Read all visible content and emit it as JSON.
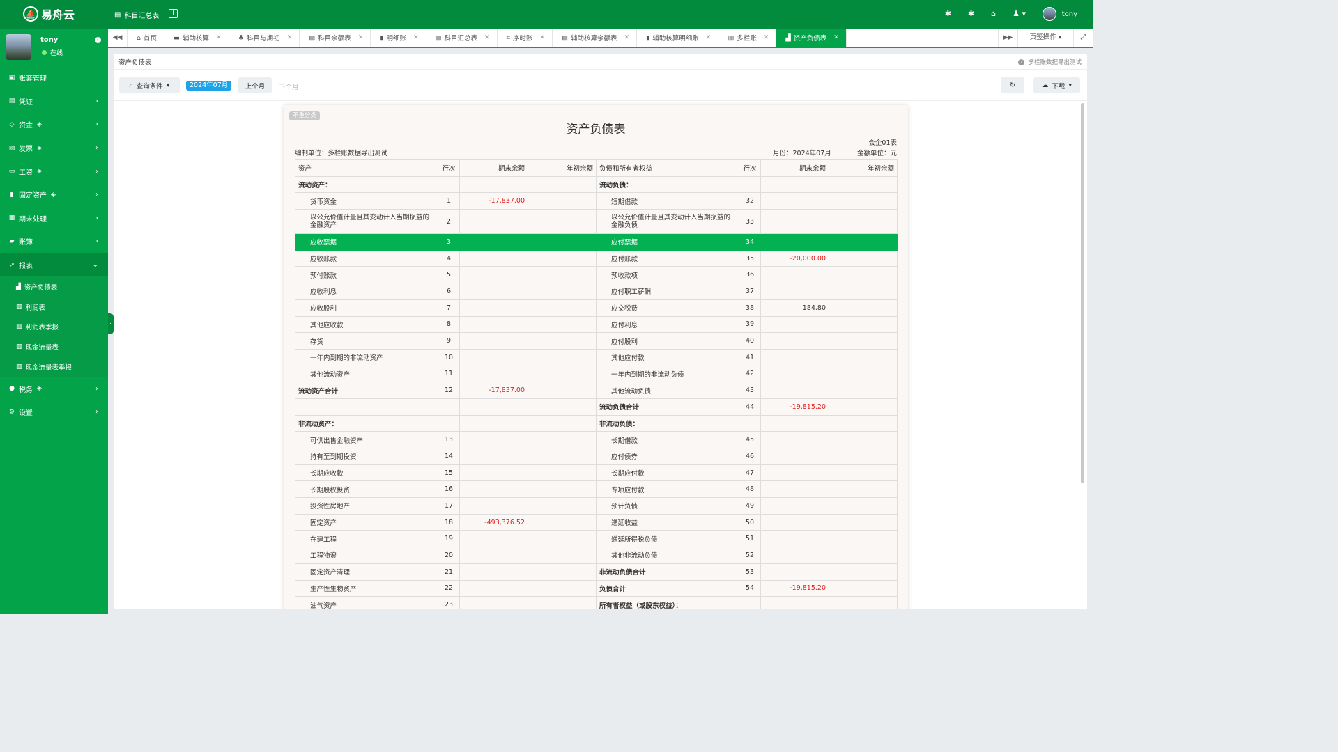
{
  "app": {
    "logo_text": "易舟云",
    "top_crumb": "科目汇总表",
    "user": "tony"
  },
  "sidebar": {
    "user_name": "tony",
    "status": "在线",
    "menu": [
      {
        "label": "账套管理",
        "icon": "book-icon",
        "gem": false,
        "chev": false
      },
      {
        "label": "凭证",
        "icon": "card-icon",
        "gem": false,
        "chev": true
      },
      {
        "label": "资金",
        "icon": "link-icon",
        "gem": true,
        "chev": true
      },
      {
        "label": "发票",
        "icon": "invoice-icon",
        "gem": true,
        "chev": true
      },
      {
        "label": "工资",
        "icon": "wallet-icon",
        "gem": true,
        "chev": true
      },
      {
        "label": "固定资产",
        "icon": "building-icon",
        "gem": true,
        "chev": true
      },
      {
        "label": "期末处理",
        "icon": "calendar-icon",
        "gem": false,
        "chev": true
      },
      {
        "label": "账簿",
        "icon": "ledger-icon",
        "gem": false,
        "chev": true
      },
      {
        "label": "报表",
        "icon": "chart-icon",
        "gem": false,
        "chev": true
      }
    ],
    "report_sub": [
      "资产负债表",
      "利润表",
      "利润表季报",
      "现金流量表",
      "现金流量表季报"
    ],
    "bottom_menu": [
      {
        "label": "税务",
        "gem": true
      },
      {
        "label": "设置",
        "gem": false
      }
    ]
  },
  "tabs": [
    "首页",
    "辅助核算",
    "科目与期初",
    "科目余额表",
    "明细账",
    "科目汇总表",
    "序时账",
    "辅助核算余额表",
    "辅助核算明细账",
    "多栏账",
    "资产负债表"
  ],
  "tab_ops": "页签操作",
  "content": {
    "header": "资产负债表",
    "hint": "多栏账数据导出测试",
    "query_btn": "查询条件",
    "month": "2024年07月",
    "prev_btn": "上个月",
    "next_btn": "下个月",
    "download_btn": "下载"
  },
  "report": {
    "badge": "不重分类",
    "title": "资产负债表",
    "form_code": "会企01表",
    "compiler": "编制单位：多栏账数据导出测试",
    "month": "月份：2024年07月",
    "unit": "金额单位：元",
    "headers": [
      "资产",
      "行次",
      "期末余额",
      "年初余额",
      "负债和所有者权益",
      "行次",
      "期末余额",
      "年初余额"
    ],
    "rows": [
      {
        "a": "流动资产：",
        "an": "",
        "ae": "",
        "ab": "",
        "l": "流动负债：",
        "ln": "",
        "le": "",
        "lb": "",
        "ab_bold": true,
        "lb_bold": true
      },
      {
        "a": "货币资金",
        "an": "1",
        "ae": "-17,837.00",
        "ab": "",
        "l": "短期借款",
        "ln": "32",
        "le": "",
        "lb": ""
      },
      {
        "a": "以公允价值计量且其变动计入当期损益的金融资产",
        "an": "2",
        "ae": "",
        "ab": "",
        "l": "以公允价值计量且其变动计入当期损益的金融负债",
        "ln": "33",
        "le": "",
        "lb": "",
        "tall": true
      },
      {
        "a": "应收票据",
        "an": "3",
        "ae": "",
        "ab": "",
        "l": "应付票据",
        "ln": "34",
        "le": "",
        "lb": "",
        "hl": true
      },
      {
        "a": "应收账款",
        "an": "4",
        "ae": "",
        "ab": "",
        "l": "应付账款",
        "ln": "35",
        "le": "-20,000.00",
        "lb": ""
      },
      {
        "a": "预付账款",
        "an": "5",
        "ae": "",
        "ab": "",
        "l": "预收款项",
        "ln": "36",
        "le": "",
        "lb": ""
      },
      {
        "a": "应收利息",
        "an": "6",
        "ae": "",
        "ab": "",
        "l": "应付职工薪酬",
        "ln": "37",
        "le": "",
        "lb": ""
      },
      {
        "a": "应收股利",
        "an": "7",
        "ae": "",
        "ab": "",
        "l": "应交税费",
        "ln": "38",
        "le": "184.80",
        "lb": ""
      },
      {
        "a": "其他应收款",
        "an": "8",
        "ae": "",
        "ab": "",
        "l": "应付利息",
        "ln": "39",
        "le": "",
        "lb": ""
      },
      {
        "a": "存货",
        "an": "9",
        "ae": "",
        "ab": "",
        "l": "应付股利",
        "ln": "40",
        "le": "",
        "lb": ""
      },
      {
        "a": "一年内到期的非流动资产",
        "an": "10",
        "ae": "",
        "ab": "",
        "l": "其他应付款",
        "ln": "41",
        "le": "",
        "lb": ""
      },
      {
        "a": "其他流动资产",
        "an": "11",
        "ae": "",
        "ab": "",
        "l": "一年内到期的非流动负债",
        "ln": "42",
        "le": "",
        "lb": ""
      },
      {
        "a": "流动资产合计",
        "an": "12",
        "ae": "-17,837.00",
        "ab": "",
        "l": "其他流动负债",
        "ln": "43",
        "le": "",
        "lb": "",
        "ab_bold": true
      },
      {
        "a": "",
        "an": "",
        "ae": "",
        "ab": "",
        "l": "流动负债合计",
        "ln": "44",
        "le": "-19,815.20",
        "lb": "",
        "lb_bold": true
      },
      {
        "a": "非流动资产：",
        "an": "",
        "ae": "",
        "ab": "",
        "l": "非流动负债：",
        "ln": "",
        "le": "",
        "lb": "",
        "ab_bold": true,
        "lb_bold": true
      },
      {
        "a": "可供出售金融资产",
        "an": "13",
        "ae": "",
        "ab": "",
        "l": "长期借款",
        "ln": "45",
        "le": "",
        "lb": ""
      },
      {
        "a": "持有至到期投资",
        "an": "14",
        "ae": "",
        "ab": "",
        "l": "应付债券",
        "ln": "46",
        "le": "",
        "lb": ""
      },
      {
        "a": "长期应收款",
        "an": "15",
        "ae": "",
        "ab": "",
        "l": "长期应付款",
        "ln": "47",
        "le": "",
        "lb": ""
      },
      {
        "a": "长期股权投资",
        "an": "16",
        "ae": "",
        "ab": "",
        "l": "专项应付款",
        "ln": "48",
        "le": "",
        "lb": ""
      },
      {
        "a": "投资性房地产",
        "an": "17",
        "ae": "",
        "ab": "",
        "l": "预计负债",
        "ln": "49",
        "le": "",
        "lb": ""
      },
      {
        "a": "固定资产",
        "an": "18",
        "ae": "-493,376.52",
        "ab": "",
        "l": "递延收益",
        "ln": "50",
        "le": "",
        "lb": ""
      },
      {
        "a": "在建工程",
        "an": "19",
        "ae": "",
        "ab": "",
        "l": "递延所得税负债",
        "ln": "51",
        "le": "",
        "lb": ""
      },
      {
        "a": "工程物资",
        "an": "20",
        "ae": "",
        "ab": "",
        "l": "其他非流动负债",
        "ln": "52",
        "le": "",
        "lb": ""
      },
      {
        "a": "固定资产清理",
        "an": "21",
        "ae": "",
        "ab": "",
        "l": "非流动负债合计",
        "ln": "53",
        "le": "",
        "lb": "",
        "lb_bold": true
      },
      {
        "a": "生产性生物资产",
        "an": "22",
        "ae": "",
        "ab": "",
        "l": "负债合计",
        "ln": "54",
        "le": "-19,815.20",
        "lb": "",
        "lb_bold": true
      },
      {
        "a": "油气资产",
        "an": "23",
        "ae": "",
        "ab": "",
        "l": "所有者权益（或股东权益）：",
        "ln": "",
        "le": "",
        "lb": "",
        "lb_bold": true
      }
    ]
  },
  "colors": {
    "brand": "#028a3d",
    "sidebar": "#03a34a",
    "highlight": "#03b153",
    "negative": "#e02020",
    "badge": "#1ea3e8"
  }
}
